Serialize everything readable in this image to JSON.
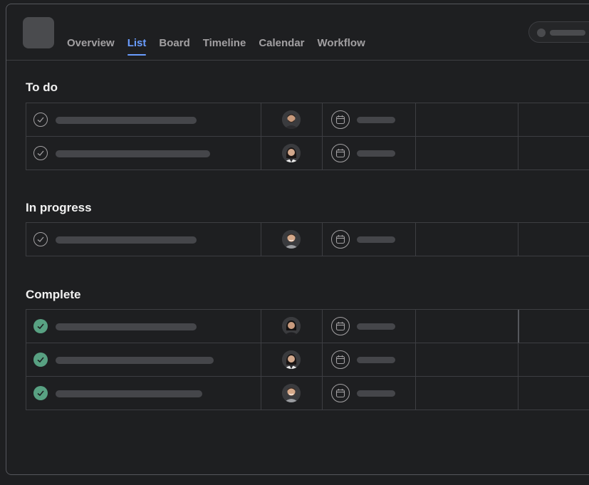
{
  "header": {
    "tabs": [
      {
        "label": "Overview",
        "active": false
      },
      {
        "label": "List",
        "active": true
      },
      {
        "label": "Board",
        "active": false
      },
      {
        "label": "Timeline",
        "active": false
      },
      {
        "label": "Calendar",
        "active": false
      },
      {
        "label": "Workflow",
        "active": false
      }
    ]
  },
  "sections": [
    {
      "title": "To do",
      "tasks": [
        {
          "complete": false,
          "assignee_icon": "avatar-man-beard"
        },
        {
          "complete": false,
          "assignee_icon": "avatar-woman"
        }
      ]
    },
    {
      "title": "In progress",
      "tasks": [
        {
          "complete": false,
          "assignee_icon": "avatar-man-smiling"
        }
      ]
    },
    {
      "title": "Complete",
      "tasks": [
        {
          "complete": true,
          "assignee_icon": "avatar-woman-dark-hair"
        },
        {
          "complete": true,
          "assignee_icon": "avatar-woman"
        },
        {
          "complete": true,
          "assignee_icon": "avatar-man-smiling"
        }
      ]
    }
  ],
  "colors": {
    "background": "#1e1f21",
    "accent": "#6a9dff",
    "complete_green": "#58a182",
    "border": "#3d3e42",
    "placeholder": "#45464a"
  }
}
